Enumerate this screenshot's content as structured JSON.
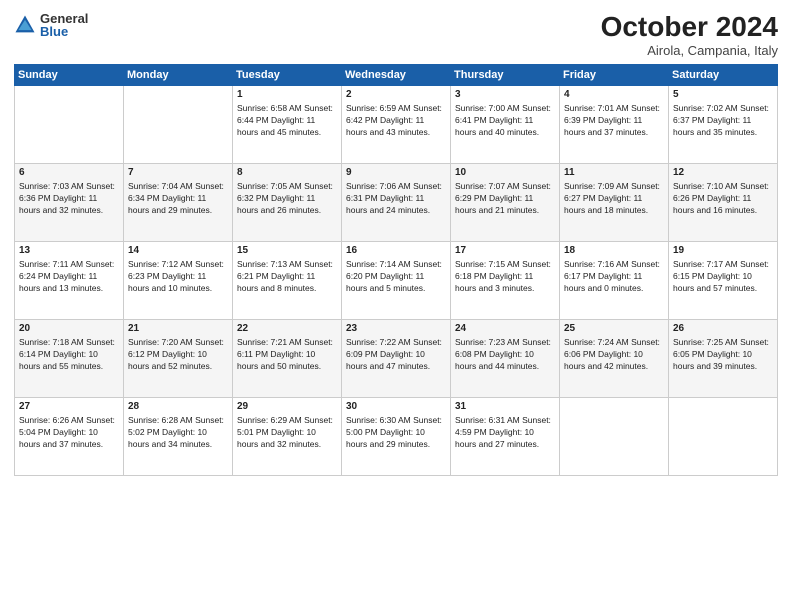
{
  "logo": {
    "general": "General",
    "blue": "Blue"
  },
  "title": "October 2024",
  "location": "Airola, Campania, Italy",
  "days_of_week": [
    "Sunday",
    "Monday",
    "Tuesday",
    "Wednesday",
    "Thursday",
    "Friday",
    "Saturday"
  ],
  "weeks": [
    [
      {
        "day": "",
        "content": ""
      },
      {
        "day": "",
        "content": ""
      },
      {
        "day": "1",
        "content": "Sunrise: 6:58 AM\nSunset: 6:44 PM\nDaylight: 11 hours and 45 minutes."
      },
      {
        "day": "2",
        "content": "Sunrise: 6:59 AM\nSunset: 6:42 PM\nDaylight: 11 hours and 43 minutes."
      },
      {
        "day": "3",
        "content": "Sunrise: 7:00 AM\nSunset: 6:41 PM\nDaylight: 11 hours and 40 minutes."
      },
      {
        "day": "4",
        "content": "Sunrise: 7:01 AM\nSunset: 6:39 PM\nDaylight: 11 hours and 37 minutes."
      },
      {
        "day": "5",
        "content": "Sunrise: 7:02 AM\nSunset: 6:37 PM\nDaylight: 11 hours and 35 minutes."
      }
    ],
    [
      {
        "day": "6",
        "content": "Sunrise: 7:03 AM\nSunset: 6:36 PM\nDaylight: 11 hours and 32 minutes."
      },
      {
        "day": "7",
        "content": "Sunrise: 7:04 AM\nSunset: 6:34 PM\nDaylight: 11 hours and 29 minutes."
      },
      {
        "day": "8",
        "content": "Sunrise: 7:05 AM\nSunset: 6:32 PM\nDaylight: 11 hours and 26 minutes."
      },
      {
        "day": "9",
        "content": "Sunrise: 7:06 AM\nSunset: 6:31 PM\nDaylight: 11 hours and 24 minutes."
      },
      {
        "day": "10",
        "content": "Sunrise: 7:07 AM\nSunset: 6:29 PM\nDaylight: 11 hours and 21 minutes."
      },
      {
        "day": "11",
        "content": "Sunrise: 7:09 AM\nSunset: 6:27 PM\nDaylight: 11 hours and 18 minutes."
      },
      {
        "day": "12",
        "content": "Sunrise: 7:10 AM\nSunset: 6:26 PM\nDaylight: 11 hours and 16 minutes."
      }
    ],
    [
      {
        "day": "13",
        "content": "Sunrise: 7:11 AM\nSunset: 6:24 PM\nDaylight: 11 hours and 13 minutes."
      },
      {
        "day": "14",
        "content": "Sunrise: 7:12 AM\nSunset: 6:23 PM\nDaylight: 11 hours and 10 minutes."
      },
      {
        "day": "15",
        "content": "Sunrise: 7:13 AM\nSunset: 6:21 PM\nDaylight: 11 hours and 8 minutes."
      },
      {
        "day": "16",
        "content": "Sunrise: 7:14 AM\nSunset: 6:20 PM\nDaylight: 11 hours and 5 minutes."
      },
      {
        "day": "17",
        "content": "Sunrise: 7:15 AM\nSunset: 6:18 PM\nDaylight: 11 hours and 3 minutes."
      },
      {
        "day": "18",
        "content": "Sunrise: 7:16 AM\nSunset: 6:17 PM\nDaylight: 11 hours and 0 minutes."
      },
      {
        "day": "19",
        "content": "Sunrise: 7:17 AM\nSunset: 6:15 PM\nDaylight: 10 hours and 57 minutes."
      }
    ],
    [
      {
        "day": "20",
        "content": "Sunrise: 7:18 AM\nSunset: 6:14 PM\nDaylight: 10 hours and 55 minutes."
      },
      {
        "day": "21",
        "content": "Sunrise: 7:20 AM\nSunset: 6:12 PM\nDaylight: 10 hours and 52 minutes."
      },
      {
        "day": "22",
        "content": "Sunrise: 7:21 AM\nSunset: 6:11 PM\nDaylight: 10 hours and 50 minutes."
      },
      {
        "day": "23",
        "content": "Sunrise: 7:22 AM\nSunset: 6:09 PM\nDaylight: 10 hours and 47 minutes."
      },
      {
        "day": "24",
        "content": "Sunrise: 7:23 AM\nSunset: 6:08 PM\nDaylight: 10 hours and 44 minutes."
      },
      {
        "day": "25",
        "content": "Sunrise: 7:24 AM\nSunset: 6:06 PM\nDaylight: 10 hours and 42 minutes."
      },
      {
        "day": "26",
        "content": "Sunrise: 7:25 AM\nSunset: 6:05 PM\nDaylight: 10 hours and 39 minutes."
      }
    ],
    [
      {
        "day": "27",
        "content": "Sunrise: 6:26 AM\nSunset: 5:04 PM\nDaylight: 10 hours and 37 minutes."
      },
      {
        "day": "28",
        "content": "Sunrise: 6:28 AM\nSunset: 5:02 PM\nDaylight: 10 hours and 34 minutes."
      },
      {
        "day": "29",
        "content": "Sunrise: 6:29 AM\nSunset: 5:01 PM\nDaylight: 10 hours and 32 minutes."
      },
      {
        "day": "30",
        "content": "Sunrise: 6:30 AM\nSunset: 5:00 PM\nDaylight: 10 hours and 29 minutes."
      },
      {
        "day": "31",
        "content": "Sunrise: 6:31 AM\nSunset: 4:59 PM\nDaylight: 10 hours and 27 minutes."
      },
      {
        "day": "",
        "content": ""
      },
      {
        "day": "",
        "content": ""
      }
    ]
  ]
}
